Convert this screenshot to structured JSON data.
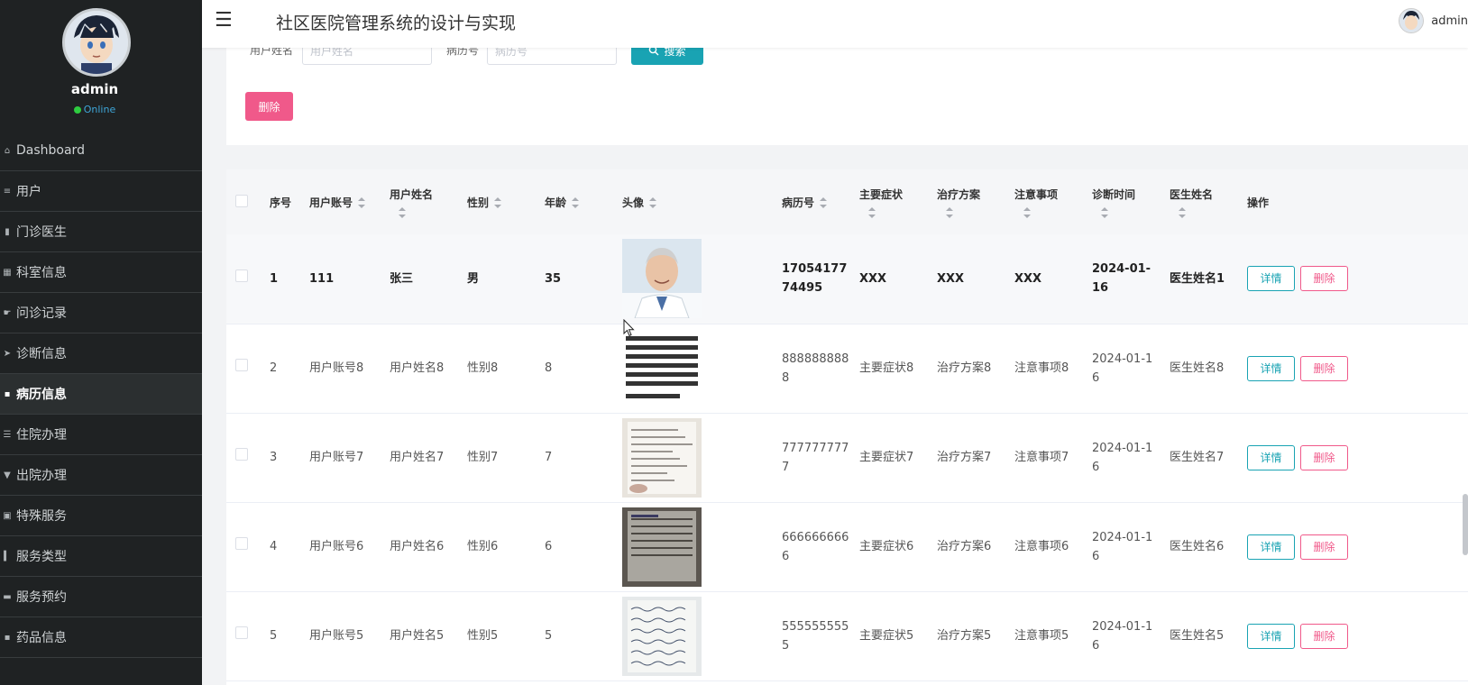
{
  "app": {
    "title": "社区医院管理系统的设计与实现"
  },
  "sidebar": {
    "username": "admin",
    "status": "Online",
    "items": [
      {
        "label": "Dashboard",
        "icon": "home-icon"
      },
      {
        "label": "用户",
        "icon": "sliders-icon"
      },
      {
        "label": "门诊医生",
        "icon": "book-icon"
      },
      {
        "label": "科室信息",
        "icon": "grid-icon"
      },
      {
        "label": "问诊记录",
        "icon": "hand-icon"
      },
      {
        "label": "诊断信息",
        "icon": "send-icon"
      },
      {
        "label": "病历信息",
        "icon": "apps-icon",
        "active": true
      },
      {
        "label": "住院办理",
        "icon": "list-icon"
      },
      {
        "label": "出院办理",
        "icon": "trophy-icon"
      },
      {
        "label": "特殊服务",
        "icon": "clipboard-icon"
      },
      {
        "label": "服务类型",
        "icon": "bar-chart-icon"
      },
      {
        "label": "服务预约",
        "icon": "monitor-icon"
      },
      {
        "label": "药品信息",
        "icon": "apps-icon"
      }
    ]
  },
  "topbar": {
    "user": "admin"
  },
  "search": {
    "name_label": "用户姓名",
    "name_placeholder": "用户姓名",
    "record_label": "病历号",
    "record_placeholder": "病历号",
    "search_button": "搜索",
    "delete_button": "删除"
  },
  "table": {
    "headers": {
      "index": "序号",
      "account": "用户账号",
      "name": "用户姓名",
      "gender": "性别",
      "age": "年龄",
      "avatar": "头像",
      "record": "病历号",
      "symptoms": "主要症状",
      "plan": "治疗方案",
      "notes": "注意事项",
      "time": "诊断时间",
      "doctor": "医生姓名",
      "ops": "操作"
    },
    "rows": [
      {
        "index": "1",
        "account": "111",
        "name": "张三",
        "gender": "男",
        "age": "35",
        "record": "1705417774495",
        "symptoms": "XXX",
        "plan": "XXX",
        "notes": "XXX",
        "time": "2024-01-16",
        "doctor": "医生姓名1",
        "thumb": "portrait"
      },
      {
        "index": "2",
        "account": "用户账号8",
        "name": "用户姓名8",
        "gender": "性别8",
        "age": "8",
        "record": "8888888888",
        "symptoms": "主要症状8",
        "plan": "治疗方案8",
        "notes": "注意事项8",
        "time": "2024-01-16",
        "doctor": "医生姓名8",
        "thumb": "text-doc"
      },
      {
        "index": "3",
        "account": "用户账号7",
        "name": "用户姓名7",
        "gender": "性别7",
        "age": "7",
        "record": "7777777777",
        "symptoms": "主要症状7",
        "plan": "治疗方案7",
        "notes": "注意事项7",
        "time": "2024-01-16",
        "doctor": "医生姓名7",
        "thumb": "paper"
      },
      {
        "index": "4",
        "account": "用户账号6",
        "name": "用户姓名6",
        "gender": "性别6",
        "age": "6",
        "record": "6666666666",
        "symptoms": "主要症状6",
        "plan": "治疗方案6",
        "notes": "注意事项6",
        "time": "2024-01-16",
        "doctor": "医生姓名6",
        "thumb": "form-dark"
      },
      {
        "index": "5",
        "account": "用户账号5",
        "name": "用户姓名5",
        "gender": "性别5",
        "age": "5",
        "record": "5555555555",
        "symptoms": "主要症状5",
        "plan": "治疗方案5",
        "notes": "注意事项5",
        "time": "2024-01-16",
        "doctor": "医生姓名5",
        "thumb": "handwritten"
      }
    ],
    "detail_button": "详情",
    "delete_button": "删除"
  },
  "colors": {
    "accent": "#19a3b3",
    "danger": "#f0598a",
    "sidebar": "#1f2223"
  }
}
